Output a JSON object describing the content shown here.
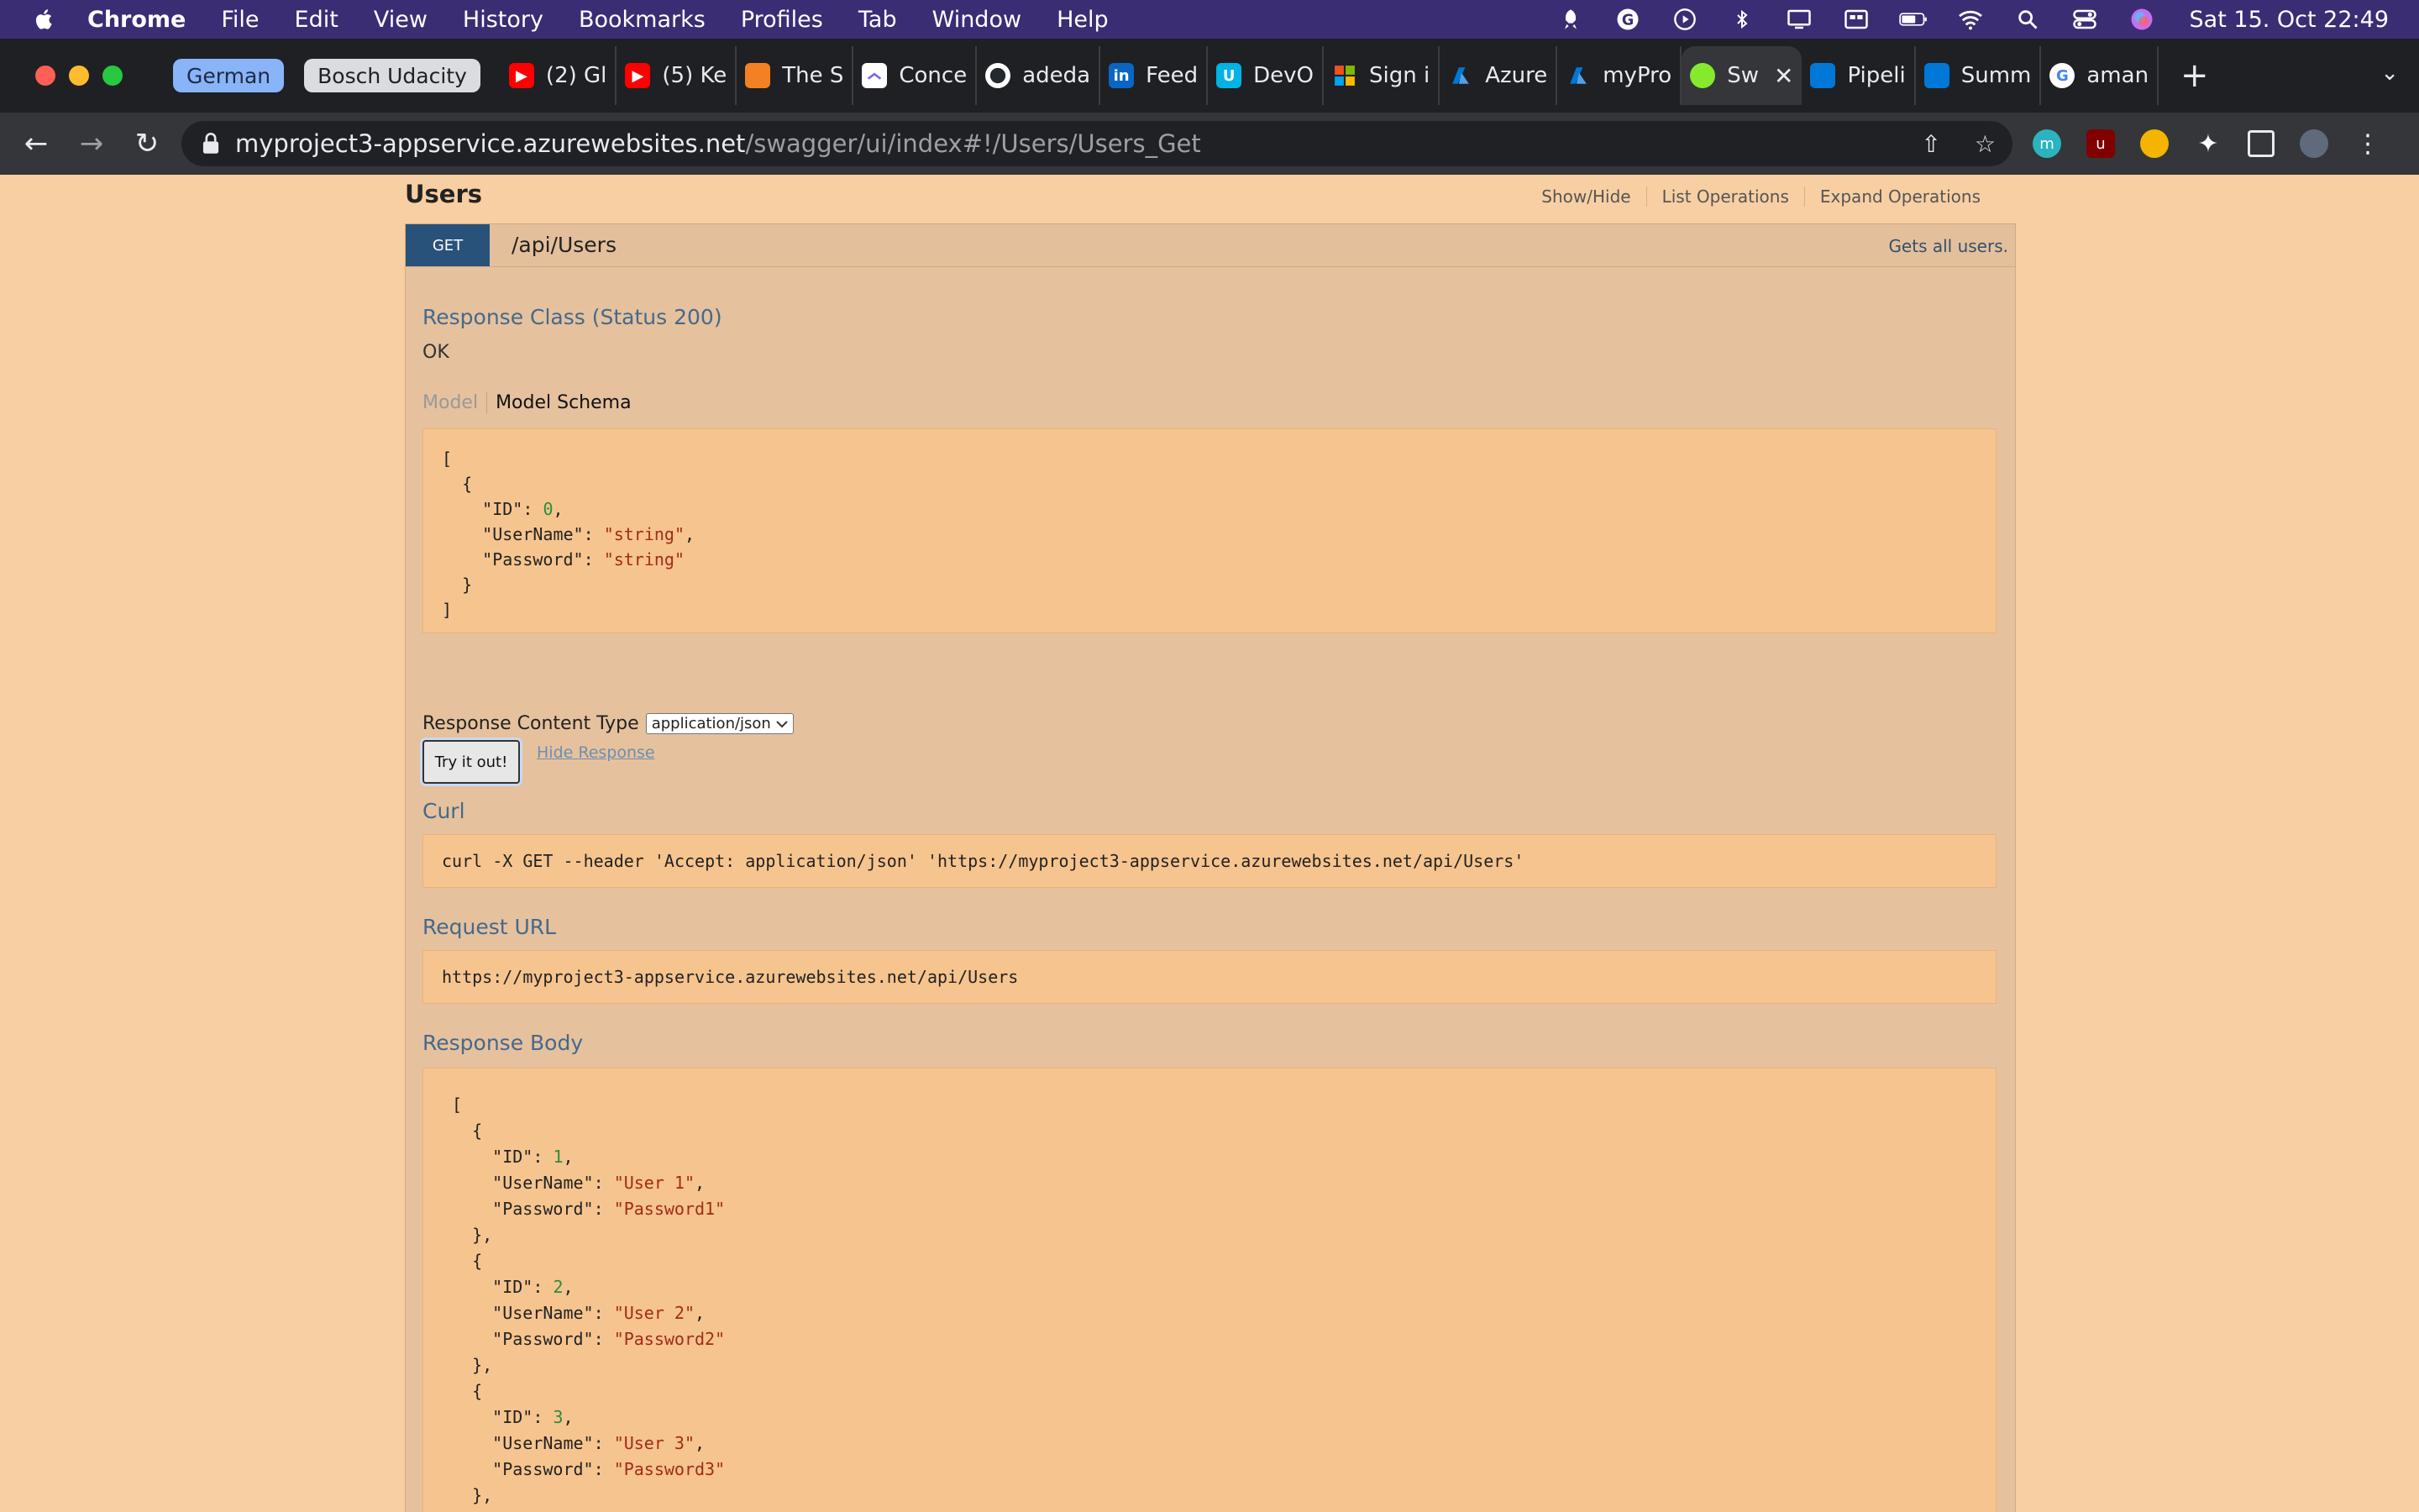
{
  "menubar": {
    "app": "Chrome",
    "items": [
      "File",
      "Edit",
      "View",
      "History",
      "Bookmarks",
      "Profiles",
      "Tab",
      "Window",
      "Help"
    ],
    "clock": "Sat 15. Oct  22:49"
  },
  "tabs": {
    "groups": [
      "German",
      "Bosch Udacity"
    ],
    "list": [
      {
        "label": "(2) Gl",
        "icon": "youtube-icon"
      },
      {
        "label": "(5) Ke",
        "icon": "youtube-icon"
      },
      {
        "label": "The S",
        "icon": "stackoverflow-icon"
      },
      {
        "label": "Conce",
        "icon": "clickup-icon"
      },
      {
        "label": "adeda",
        "icon": "github-icon"
      },
      {
        "label": "Feed",
        "icon": "linkedin-icon"
      },
      {
        "label": "DevO",
        "icon": "udacity-icon"
      },
      {
        "label": "Sign i",
        "icon": "microsoft-icon"
      },
      {
        "label": "Azure",
        "icon": "azure-icon"
      },
      {
        "label": "myPro",
        "icon": "azure-icon"
      },
      {
        "label": "Sw",
        "icon": "swagger-icon",
        "active": true
      },
      {
        "label": "Pipeli",
        "icon": "azure-devops-icon"
      },
      {
        "label": "Summ",
        "icon": "azure-devops-icon"
      },
      {
        "label": "aman",
        "icon": "google-icon"
      }
    ]
  },
  "address": {
    "host": "myproject3-appservice.azurewebsites.net",
    "path": "/swagger/ui/index#!/Users/Users_Get"
  },
  "resource": {
    "title": "Users",
    "links": [
      "Show/Hide",
      "List Operations",
      "Expand Operations"
    ]
  },
  "operation": {
    "method": "GET",
    "path": "/api/Users",
    "summary": "Gets all users."
  },
  "response_class": {
    "heading": "Response Class (Status 200)",
    "status_text": "OK",
    "tabs": [
      "Model",
      "Model Schema"
    ]
  },
  "response_content_type": {
    "label": "Response Content Type",
    "selected": "application/json"
  },
  "buttons": {
    "try": "Try it out!",
    "hide": "Hide Response"
  },
  "curl": {
    "heading": "Curl",
    "command": "curl -X GET --header 'Accept: application/json' 'https://myproject3-appservice.azurewebsites.net/api/Users'"
  },
  "request_url": {
    "heading": "Request URL",
    "value": "https://myproject3-appservice.azurewebsites.net/api/Users"
  },
  "response_body": {
    "heading": "Response Body"
  },
  "colors": {
    "menubar": "#3b2d74",
    "page_bg": "#f8cfa3",
    "get_method": "#28527a",
    "code_bg": "#f6c48e"
  }
}
